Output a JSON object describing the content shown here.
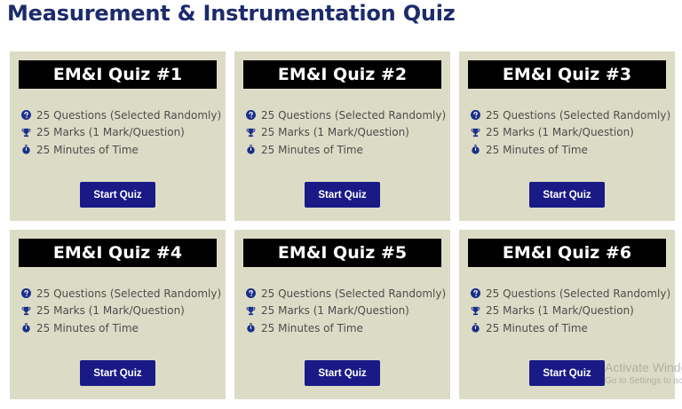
{
  "page": {
    "title": "Measurement & Instrumentation Quiz"
  },
  "quizzes": [
    {
      "title": "EM&I Quiz #1",
      "questions": "25 Questions (Selected Randomly)",
      "marks": "25 Marks (1 Mark/Question)",
      "time": "25 Minutes of Time",
      "button": "Start Quiz"
    },
    {
      "title": "EM&I Quiz #2",
      "questions": "25 Questions (Selected Randomly)",
      "marks": "25 Marks (1 Mark/Question)",
      "time": "25 Minutes of Time",
      "button": "Start Quiz"
    },
    {
      "title": "EM&I Quiz #3",
      "questions": "25 Questions (Selected Randomly)",
      "marks": "25 Marks (1 Mark/Question)",
      "time": "25 Minutes of Time",
      "button": "Start Quiz"
    },
    {
      "title": "EM&I Quiz #4",
      "questions": "25 Questions (Selected Randomly)",
      "marks": "25 Marks (1 Mark/Question)",
      "time": "25 Minutes of Time",
      "button": "Start Quiz"
    },
    {
      "title": "EM&I Quiz #5",
      "questions": "25 Questions (Selected Randomly)",
      "marks": "25 Marks (1 Mark/Question)",
      "time": "25 Minutes of Time",
      "button": "Start Quiz"
    },
    {
      "title": "EM&I Quiz #6",
      "questions": "25 Questions (Selected Randomly)",
      "marks": "25 Marks (1 Mark/Question)",
      "time": "25 Minutes of Time",
      "button": "Start Quiz"
    }
  ],
  "icons": {
    "questions": "question-circle-icon",
    "marks": "trophy-icon",
    "time": "stopwatch-icon"
  },
  "colors": {
    "title": "#1d2b6b",
    "card_bg": "#dcdcc6",
    "card_header": "#000000",
    "button": "#1a1a87",
    "icon": "#1b2f8a"
  },
  "watermark": {
    "line1": "Activate Windows",
    "line2": "Go to Settings to activate Windows."
  }
}
